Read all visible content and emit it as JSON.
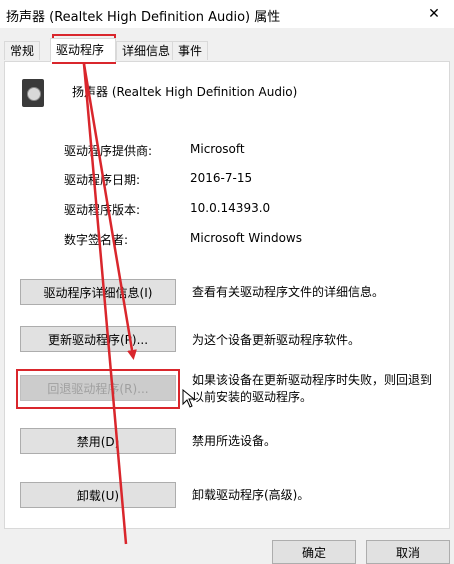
{
  "window": {
    "title": "扬声器 (Realtek High Definition Audio) 属性",
    "close_glyph": "✕"
  },
  "tabs": [
    {
      "label": "常规",
      "active": false
    },
    {
      "label": "驱动程序",
      "active": true
    },
    {
      "label": "详细信息",
      "active": false
    },
    {
      "label": "事件",
      "active": false
    }
  ],
  "device": {
    "name": "扬声器 (Realtek High Definition Audio)",
    "icon": "speaker-icon"
  },
  "info": [
    {
      "label": "驱动程序提供商:",
      "value": "Microsoft"
    },
    {
      "label": "驱动程序日期:",
      "value": "2016-7-15"
    },
    {
      "label": "驱动程序版本:",
      "value": "10.0.14393.0"
    },
    {
      "label": "数字签名者:",
      "value": "Microsoft Windows"
    }
  ],
  "actions": [
    {
      "label": "驱动程序详细信息(I)",
      "desc": "查看有关驱动程序文件的详细信息。",
      "enabled": true
    },
    {
      "label": "更新驱动程序(P)...",
      "desc": "为这个设备更新驱动程序软件。",
      "enabled": true
    },
    {
      "label": "回退驱动程序(R)...",
      "desc": "如果该设备在更新驱动程序时失败，则回退到以前安装的驱动程序。",
      "enabled": false
    },
    {
      "label": "禁用(D)",
      "desc": "禁用所选设备。",
      "enabled": true
    },
    {
      "label": "卸载(U)",
      "desc": "卸载驱动程序(高级)。",
      "enabled": true
    }
  ],
  "footer": {
    "ok_label": "确定",
    "cancel_label": "取消"
  },
  "annotation_color": "#d9262c"
}
